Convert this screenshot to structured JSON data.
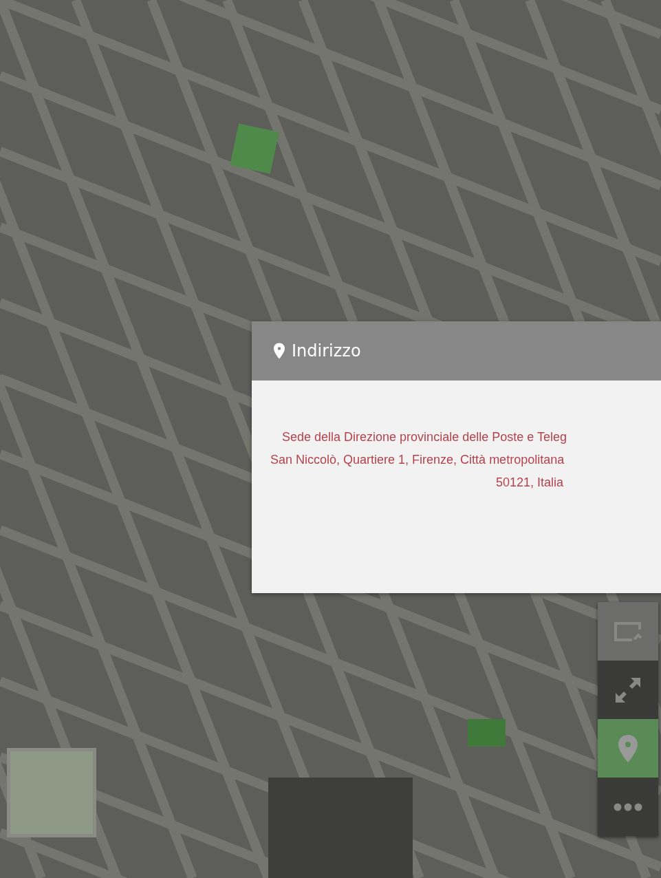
{
  "popup": {
    "title": "Indirizzo",
    "address_lines": [
      "Sede della Direzione provinciale delle Poste e Teleg",
      "San Niccolò, Quartiere 1, Firenze, Città metropolitana",
      "50121, Italia"
    ]
  },
  "map_controls": [
    {
      "kind": "share",
      "selected": false
    },
    {
      "kind": "fullscreen",
      "selected": false
    },
    {
      "kind": "location",
      "selected": true
    },
    {
      "kind": "more",
      "selected": false
    }
  ]
}
